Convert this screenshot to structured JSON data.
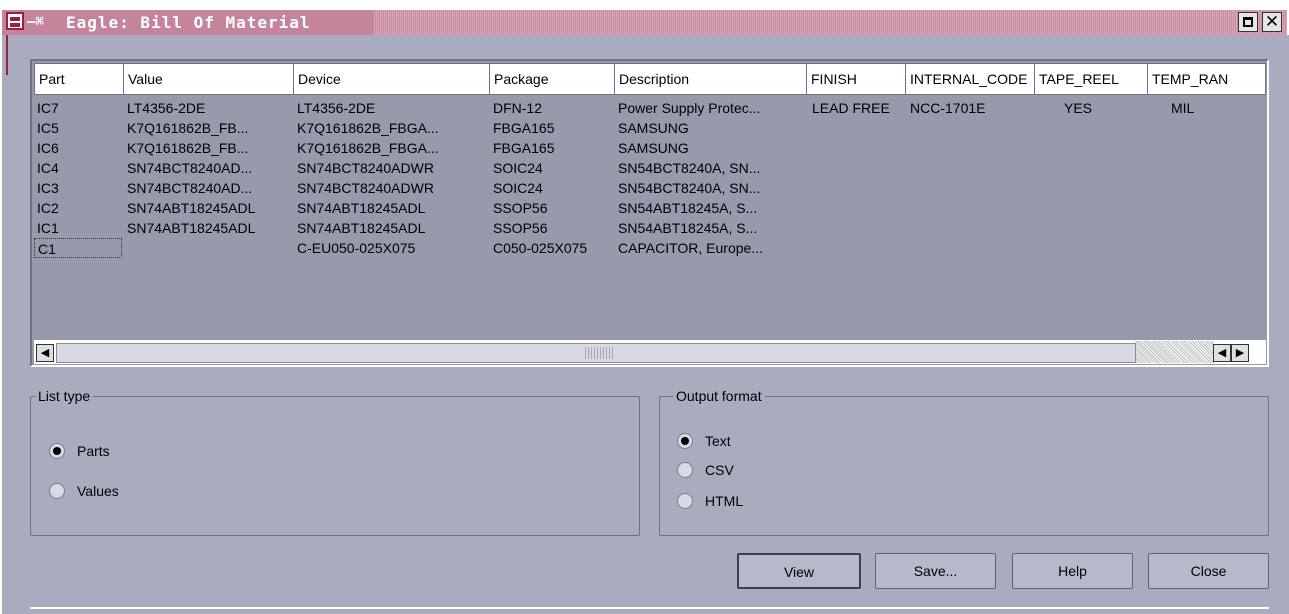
{
  "window": {
    "title": "Eagle: Bill Of Material",
    "pin_glyph": "—⌘"
  },
  "table": {
    "columns": [
      "Part",
      "Value",
      "Device",
      "Package",
      "Description",
      "FINISH",
      "INTERNAL_CODE",
      "TAPE_REEL",
      "TEMP_RAN"
    ],
    "rows": [
      [
        "IC7",
        "LT4356-2DE",
        "LT4356-2DE",
        "DFN-12",
        "Power Supply Protec...",
        "LEAD FREE",
        "NCC-1701E",
        "YES",
        "MIL"
      ],
      [
        "IC5",
        "K7Q161862B_FB...",
        "K7Q161862B_FBGA...",
        "FBGA165",
        "SAMSUNG",
        "",
        "",
        "",
        ""
      ],
      [
        "IC6",
        "K7Q161862B_FB...",
        "K7Q161862B_FBGA...",
        "FBGA165",
        "SAMSUNG",
        "",
        "",
        "",
        ""
      ],
      [
        "IC4",
        "SN74BCT8240AD...",
        "SN74BCT8240ADWR",
        "SOIC24",
        "SN54BCT8240A, SN...",
        "",
        "",
        "",
        ""
      ],
      [
        "IC3",
        "SN74BCT8240AD...",
        "SN74BCT8240ADWR",
        "SOIC24",
        "SN54BCT8240A, SN...",
        "",
        "",
        "",
        ""
      ],
      [
        "IC2",
        "SN74ABT18245ADL",
        "SN74ABT18245ADL",
        "SSOP56",
        "SN54ABT18245A, S...",
        "",
        "",
        "",
        ""
      ],
      [
        "IC1",
        "SN74ABT18245ADL",
        "SN74ABT18245ADL",
        "SSOP56",
        "SN54ABT18245A, S...",
        "",
        "",
        "",
        ""
      ],
      [
        "C1",
        "",
        "C-EU050-025X075",
        "C050-025X075",
        "CAPACITOR, Europe...",
        "",
        "",
        "",
        ""
      ]
    ]
  },
  "list_type": {
    "legend": "List type",
    "options": [
      {
        "label": "Parts",
        "checked": true
      },
      {
        "label": "Values",
        "checked": false
      }
    ]
  },
  "output_format": {
    "legend": "Output format",
    "options": [
      {
        "label": "Text",
        "checked": true
      },
      {
        "label": "CSV",
        "checked": false
      },
      {
        "label": "HTML",
        "checked": false
      }
    ]
  },
  "buttons": {
    "view": "View",
    "save": "Save...",
    "help": "Help",
    "close": "Close"
  },
  "icons": {
    "app": "eagle-app-icon",
    "pin": "pin-icon",
    "maximize": "maximize-icon",
    "close": "close-icon",
    "scroll_left": "arrow-left-icon",
    "scroll_right": "arrow-right-icon"
  },
  "colors": {
    "title_bar": "#c4859c",
    "window_bg": "#a9acbe",
    "table_bg": "#979aab"
  }
}
